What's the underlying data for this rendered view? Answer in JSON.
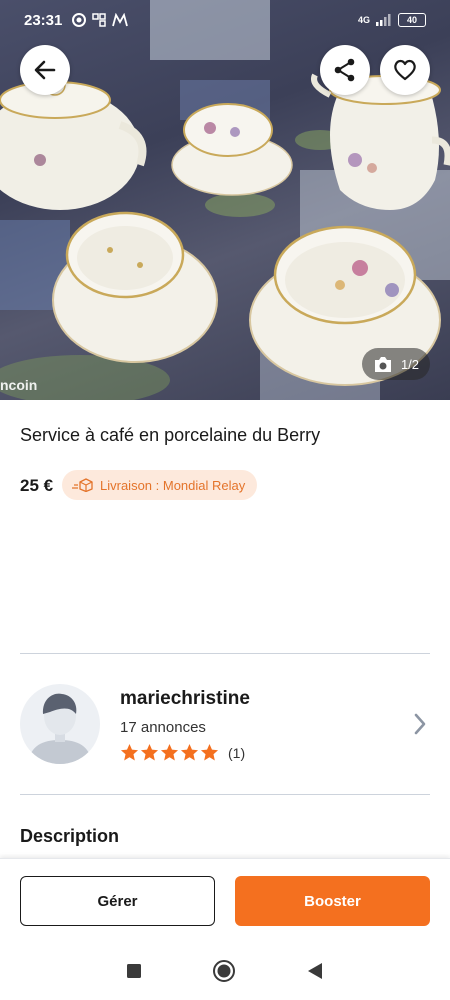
{
  "status_bar": {
    "time": "23:31",
    "signal": "4G",
    "battery": "40"
  },
  "gallery": {
    "counter": "1/2",
    "watermark": "ncoin"
  },
  "listing": {
    "title": "Service à café en porcelaine du Berry",
    "price": "25 €",
    "delivery_label": "Livraison : Mondial Relay"
  },
  "seller": {
    "name": "mariechristine",
    "ads_count": "17 annonces",
    "rating_stars": 5,
    "review_count": "(1)"
  },
  "description": {
    "heading": "Description"
  },
  "actions": {
    "manage_label": "Gérer",
    "boost_label": "Booster"
  },
  "colors": {
    "accent": "#f4701f",
    "badge_bg": "#fde9dc",
    "badge_text": "#e4742b",
    "divider": "#cdd3dc"
  },
  "icons": [
    "back-arrow-icon",
    "share-icon",
    "heart-icon",
    "camera-icon",
    "parcel-icon",
    "star-icon",
    "chevron-right-icon",
    "nav-recents-icon",
    "nav-home-icon",
    "nav-back-icon"
  ]
}
